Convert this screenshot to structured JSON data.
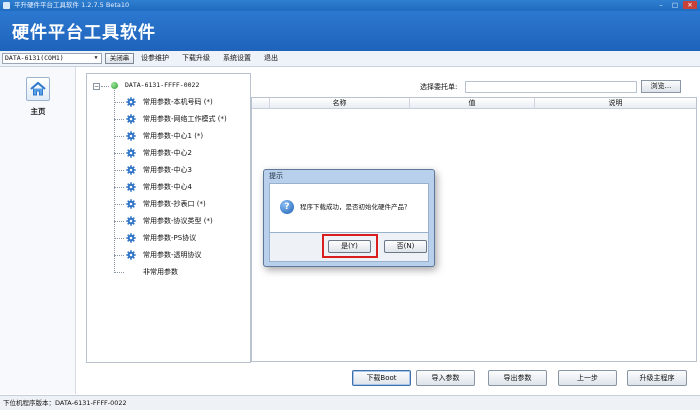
{
  "window": {
    "title": "平升硬件平台工具软件 1.2.7.5 Beta10",
    "controls": {
      "minimize": "–",
      "maximize": "□",
      "close": "✕"
    }
  },
  "banner": {
    "app_name": "硬件平台工具软件"
  },
  "menubar": {
    "device_select": "DATA-6131(COM1)",
    "close_button": "关闭串",
    "items": [
      "设参维护",
      "下载升级",
      "系统设置",
      "退出"
    ]
  },
  "sidebar": {
    "home_label": "主页",
    "home_icon": "home-icon"
  },
  "tree": {
    "root_label": "DATA-6131-FFFF-0022",
    "root_status_color": "#2a9a2a",
    "expander": "−",
    "items": [
      "常用参数-本机号码 (*)",
      "常用参数-网络工作模式 (*)",
      "常用参数-中心1 (*)",
      "常用参数-中心2",
      "常用参数-中心3",
      "常用参数-中心4",
      "常用参数-抄表口 (*)",
      "常用参数-协议类型 (*)",
      "常用参数-PS协议",
      "常用参数-透明协议",
      "非常用参数"
    ]
  },
  "file_select": {
    "label": "选择委托单:",
    "value": "",
    "browse_label": "浏览..."
  },
  "grid": {
    "columns": [
      "名称",
      "值",
      "说明"
    ]
  },
  "dialog": {
    "title": "提示",
    "icon": "question-icon",
    "message": "程序下载成功，是否初始化硬件产品？",
    "yes_label": "是(Y)",
    "no_label": "否(N)",
    "highlight_color": "#d81e1e"
  },
  "actions": [
    "下载Boot",
    "导入参数",
    "导出参数",
    "上一步",
    "升级主程序"
  ],
  "status": {
    "text": "下位机程序版本：DATA-6131-FFFF-0022"
  }
}
